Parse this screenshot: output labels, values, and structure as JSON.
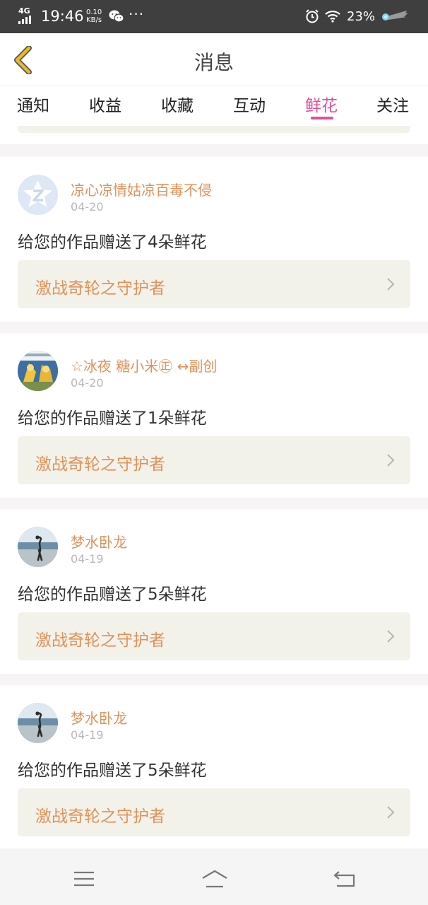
{
  "status_bar": {
    "network": "4G",
    "time": "19:46",
    "speed_value": "0.10",
    "speed_unit": "KB/s",
    "more": "···",
    "battery": "23%",
    "icons": [
      "signal-icon",
      "wechat-icon",
      "alarm-icon",
      "wifi-icon",
      "comet-icon"
    ]
  },
  "header": {
    "title": "消息",
    "back_icon": "back-chevron-icon",
    "accent_color": "#e44f98",
    "back_color": "#e8b82a"
  },
  "tabs": [
    {
      "label": "通知",
      "active": false
    },
    {
      "label": "收益",
      "active": false
    },
    {
      "label": "收藏",
      "active": false
    },
    {
      "label": "互动",
      "active": false
    },
    {
      "label": "鲜花",
      "active": true
    },
    {
      "label": "关注",
      "active": false
    }
  ],
  "messages": [
    {
      "name": "凉心凉情姑凉百毒不侵",
      "date": "04-20",
      "text": "给您的作品赠送了4朵鲜花",
      "work": "激战奇轮之守护者",
      "avatar": "default-avatar"
    },
    {
      "name": "☆冰夜 糖小米㊣ ↔副创",
      "date": "04-20",
      "text": "给您的作品赠送了1朵鲜花",
      "work": "激战奇轮之守护者",
      "avatar": "cartoon-avatar"
    },
    {
      "name": "梦水卧龙",
      "date": "04-19",
      "text": "给您的作品赠送了5朵鲜花",
      "work": "激战奇轮之守护者",
      "avatar": "photo-avatar"
    },
    {
      "name": "梦水卧龙",
      "date": "04-19",
      "text": "给您的作品赠送了5朵鲜花",
      "work": "激战奇轮之守护者",
      "avatar": "photo-avatar"
    }
  ],
  "nav": [
    "menu-icon",
    "home-icon",
    "back-icon"
  ]
}
